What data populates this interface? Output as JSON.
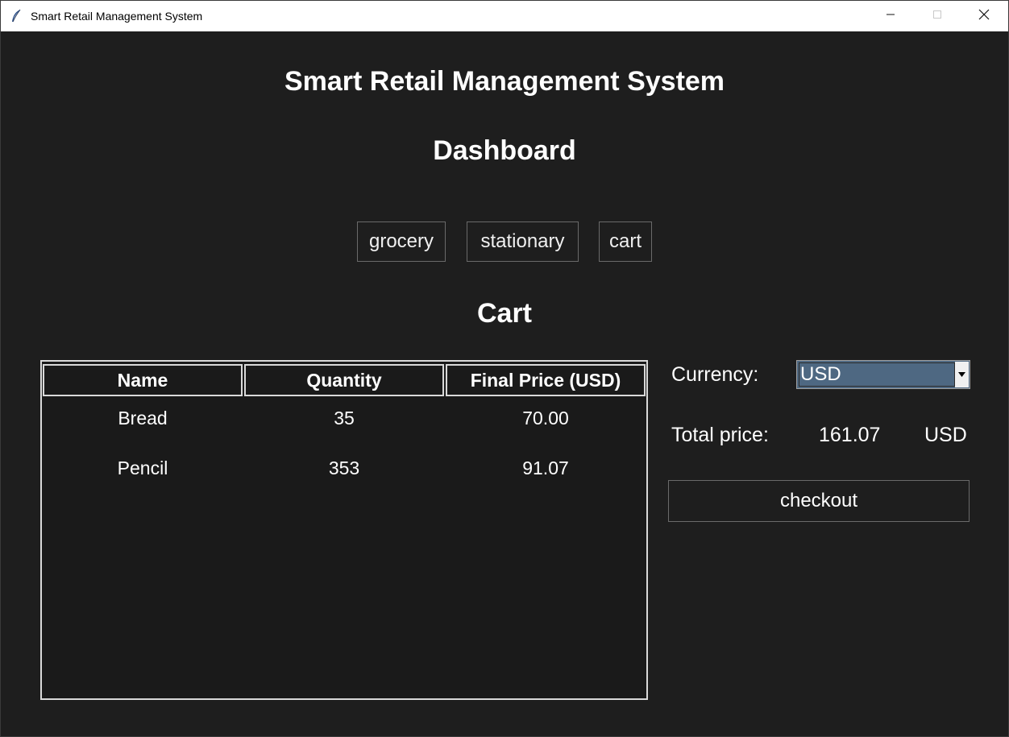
{
  "window": {
    "title": "Smart Retail Management System"
  },
  "header": {
    "app_title": "Smart Retail Management System",
    "section_title": "Dashboard"
  },
  "nav": {
    "buttons": [
      "grocery",
      "stationary",
      "cart"
    ]
  },
  "cart": {
    "title": "Cart",
    "columns": [
      "Name",
      "Quantity",
      "Final Price (USD)"
    ],
    "rows": [
      [
        "Bread",
        "35",
        "70.00"
      ],
      [
        "Pencil",
        "353",
        "91.07"
      ]
    ]
  },
  "sidebar": {
    "currency_label": "Currency:",
    "currency_selected": "USD",
    "total_label": "Total price:",
    "total_value": "161.07",
    "total_currency": "USD",
    "checkout_label": "checkout"
  },
  "icons": {
    "app": "feather-icon",
    "minimize": "minimize-icon",
    "maximize": "maximize-icon",
    "close": "close-icon",
    "dropdown": "dropdown-arrow-icon"
  },
  "colors": {
    "background": "#1e1e1e",
    "combo_selected": "#4e6882",
    "text": "#ffffff",
    "border": "#d9d9d9"
  }
}
